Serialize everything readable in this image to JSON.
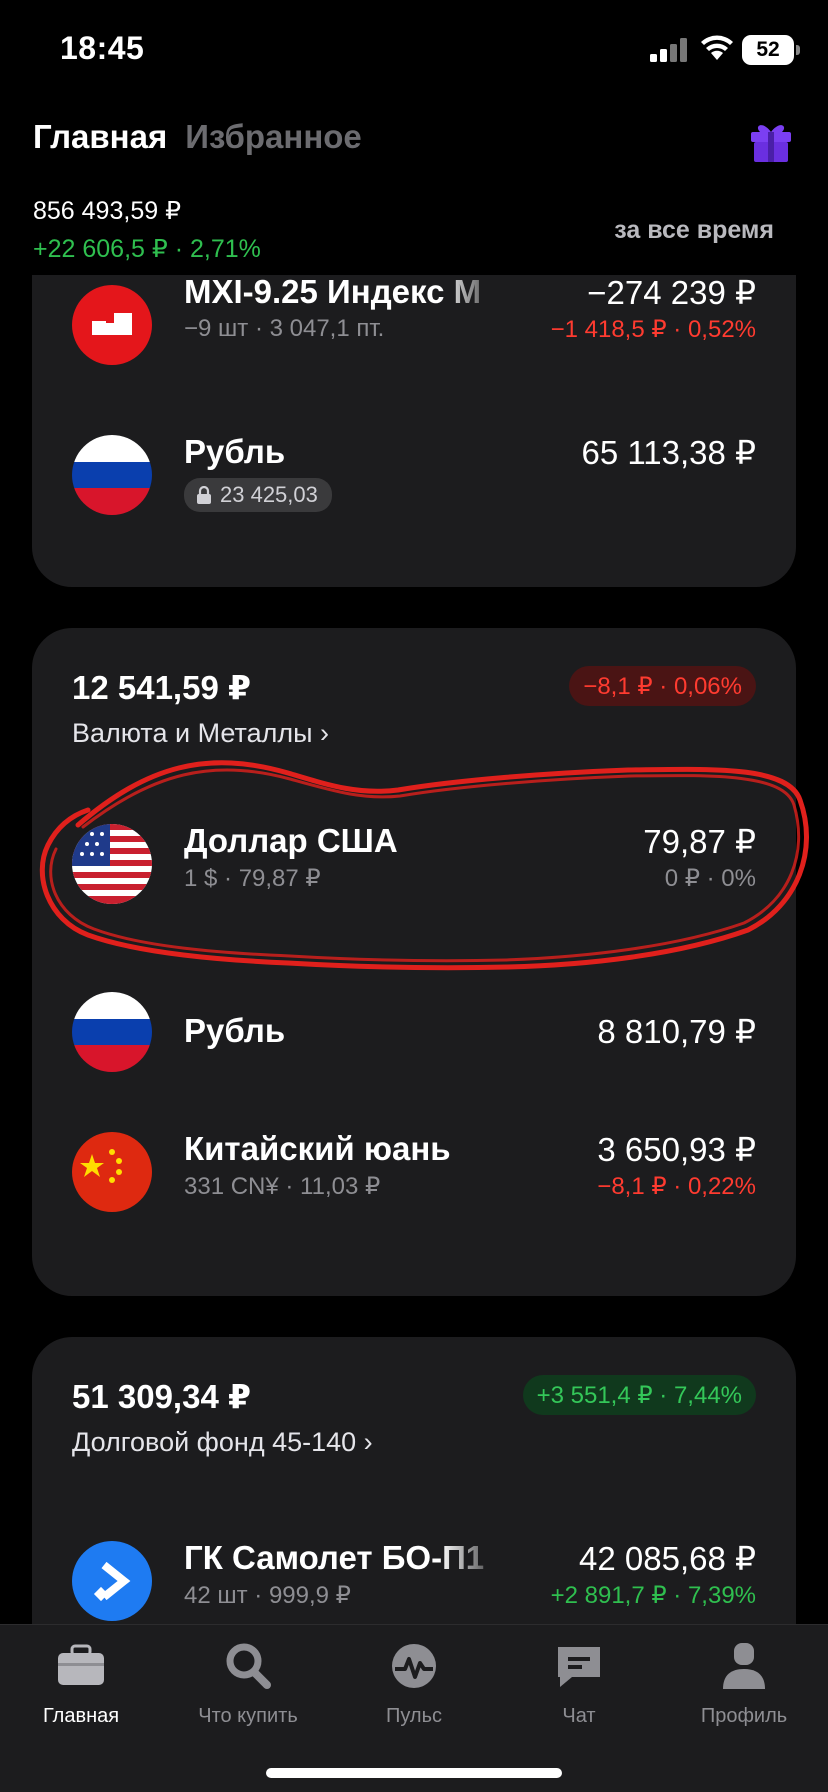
{
  "status_bar": {
    "time": "18:45",
    "battery": "52"
  },
  "header": {
    "tabs": [
      {
        "label": "Главная",
        "active": true
      },
      {
        "label": "Избранное",
        "active": false
      }
    ],
    "total_value": "856 493,59 ₽",
    "total_change": "+22 606,5 ₽ · 2,71%",
    "period": "за все время"
  },
  "card1": {
    "rows": [
      {
        "name": "MXI-9.25 Индекс М",
        "sub": "−9 шт · 3 047,1 пт.",
        "value": "−274 239 ₽",
        "change": "−1 418,5 ₽ · 0,52%",
        "change_sign": "neg",
        "icon": "moex-icon"
      },
      {
        "name": "Рубль",
        "locked": "23 425,03",
        "value": "65 113,38 ₽",
        "icon": "russia-flag-icon"
      }
    ]
  },
  "card2": {
    "total": "12 541,59 ₽",
    "change": "−8,1 ₽ · 0,06%",
    "change_sign": "neg",
    "group_name": "Валюта и Металлы ›",
    "rows": [
      {
        "name": "Доллар США",
        "sub": "1 $ · 79,87 ₽",
        "value": "79,87 ₽",
        "change": "0 ₽ · 0%",
        "change_sign": "neutral",
        "icon": "usa-flag-icon"
      },
      {
        "name": "Рубль",
        "value": "8 810,79 ₽",
        "icon": "russia-flag-icon"
      },
      {
        "name": "Китайский юань",
        "sub": "331 CN¥ · 11,03 ₽",
        "value": "3 650,93 ₽",
        "change": "−8,1 ₽ · 0,22%",
        "change_sign": "neg",
        "icon": "china-flag-icon"
      }
    ]
  },
  "card3": {
    "total": "51 309,34 ₽",
    "change": "+3 551,4 ₽ · 7,44%",
    "change_sign": "pos",
    "group_name": "Долговой фонд 45-140 ›",
    "rows": [
      {
        "name": "ГК Самолет БО-П1",
        "sub": "42 шт · 999,9 ₽",
        "value": "42 085,68 ₽",
        "change": "+2 891,7 ₽ · 7,39%",
        "change_sign": "pos",
        "icon": "samolet-icon"
      }
    ]
  },
  "tabbar": {
    "items": [
      {
        "label": "Главная",
        "icon": "briefcase-icon",
        "active": true
      },
      {
        "label": "Что купить",
        "icon": "search-icon",
        "active": false
      },
      {
        "label": "Пульс",
        "icon": "pulse-icon",
        "active": false
      },
      {
        "label": "Чат",
        "icon": "chat-icon",
        "active": false
      },
      {
        "label": "Профиль",
        "icon": "profile-icon",
        "active": false
      }
    ]
  },
  "colors": {
    "positive": "#2fbf4f",
    "negative": "#ff3b30",
    "card": "#1c1c1e",
    "highlight": "#e0201c"
  }
}
